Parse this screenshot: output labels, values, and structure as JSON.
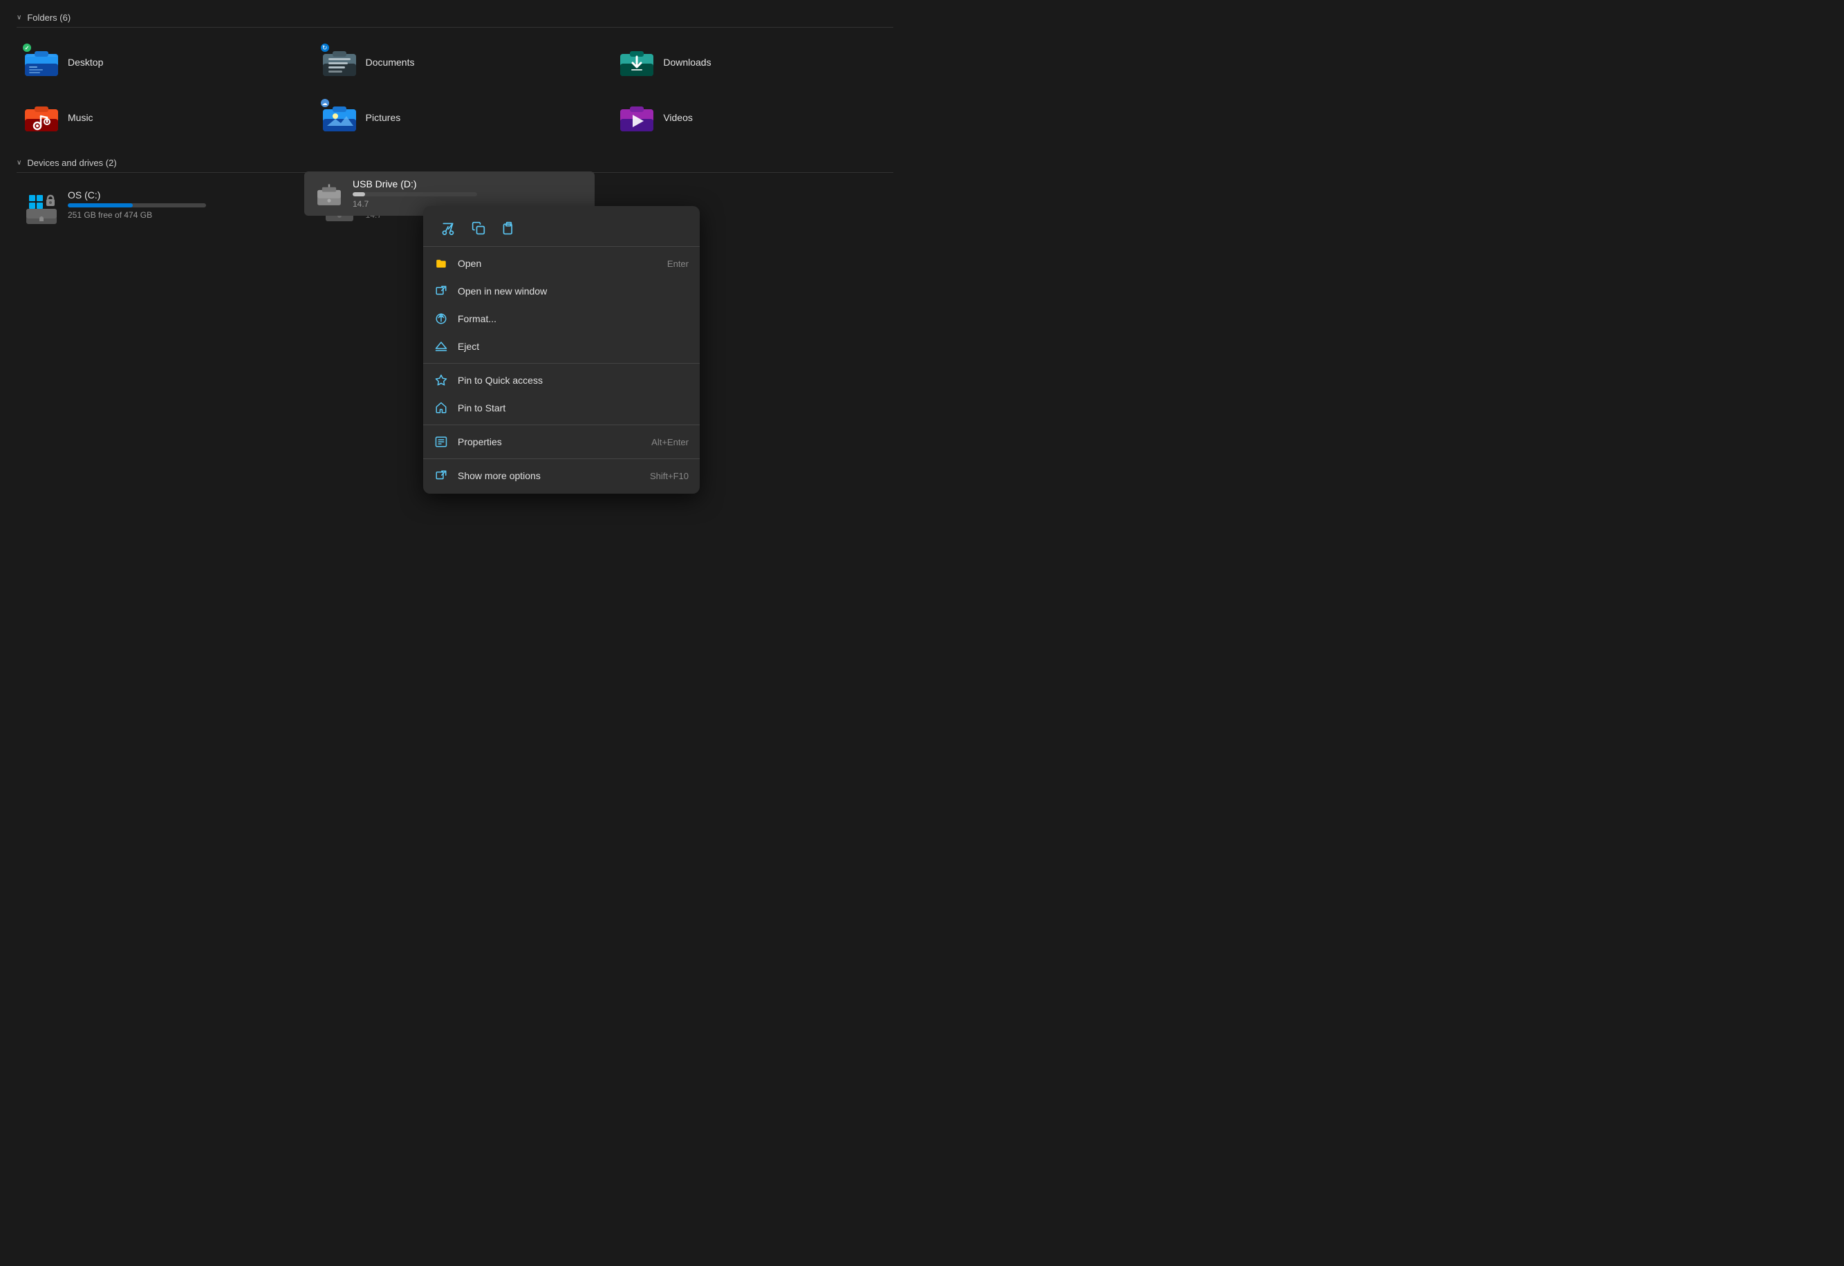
{
  "folders_section": {
    "label": "Folders (6)",
    "items": [
      {
        "id": "desktop",
        "name": "Desktop",
        "badge": "check",
        "color_top": "#3a9fd5",
        "color_bottom": "#1a6fa8"
      },
      {
        "id": "documents",
        "name": "Documents",
        "badge": "sync",
        "color_top": "#4a8ec0",
        "color_bottom": "#2a5a90"
      },
      {
        "id": "downloads",
        "name": "Downloads",
        "badge": "none",
        "color_top": "#00b894",
        "color_bottom": "#007a5e"
      },
      {
        "id": "music",
        "name": "Music",
        "badge": "none",
        "color_top": "#e07030",
        "color_bottom": "#a04010"
      },
      {
        "id": "pictures",
        "name": "Pictures",
        "badge": "cloud",
        "color_top": "#3a9fd5",
        "color_bottom": "#1a6fa0"
      },
      {
        "id": "videos",
        "name": "Videos",
        "badge": "none",
        "color_top": "#8a44c8",
        "color_bottom": "#5a2090"
      }
    ]
  },
  "drives_section": {
    "label": "Devices and drives (2)",
    "items": [
      {
        "id": "c_drive",
        "name": "OS (C:)",
        "free": "251 GB free of 474 GB",
        "fill_pct": 47,
        "bar_color": "blue"
      },
      {
        "id": "d_drive",
        "name": "USB Drive (D:)",
        "free": "14.7",
        "fill_pct": 10,
        "bar_color": "light"
      }
    ]
  },
  "context_menu": {
    "toolbar": {
      "cut_label": "✂",
      "copy_label": "⧉",
      "paste_label": "⧉"
    },
    "items": [
      {
        "id": "open",
        "label": "Open",
        "shortcut": "Enter",
        "icon": "folder"
      },
      {
        "id": "open_new_window",
        "label": "Open in new window",
        "shortcut": "",
        "icon": "external"
      },
      {
        "id": "format",
        "label": "Format...",
        "shortcut": "",
        "icon": "format"
      },
      {
        "id": "eject",
        "label": "Eject",
        "shortcut": "",
        "icon": "eject"
      },
      {
        "id": "pin_quick",
        "label": "Pin to Quick access",
        "shortcut": "",
        "icon": "star"
      },
      {
        "id": "pin_start",
        "label": "Pin to Start",
        "shortcut": "",
        "icon": "pin"
      },
      {
        "id": "properties",
        "label": "Properties",
        "shortcut": "Alt+Enter",
        "icon": "properties"
      },
      {
        "id": "show_more",
        "label": "Show more options",
        "shortcut": "Shift+F10",
        "icon": "more"
      }
    ]
  }
}
